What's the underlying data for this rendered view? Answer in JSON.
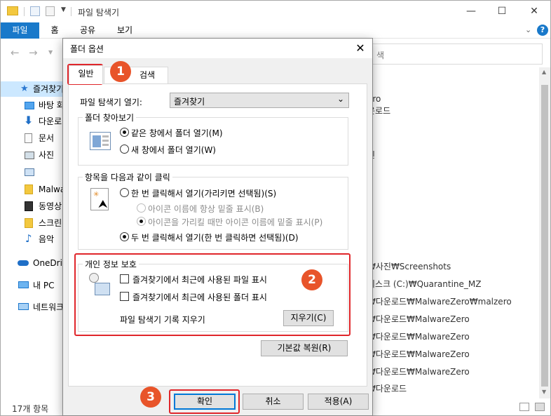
{
  "explorer": {
    "window_title": "파일 탐색기",
    "ribbon": {
      "file": "파일",
      "home": "홈",
      "share": "공유",
      "view": "보기"
    },
    "search_partial": "색",
    "nav_items": [
      "즐겨찾기",
      "바탕 화",
      "다운로",
      "문서",
      "사진",
      "",
      "Malwa",
      "동영상",
      "스크린",
      "음악",
      "OneDriv",
      "내 PC",
      "네트워크"
    ],
    "right_top": [
      "ero",
      "운로드",
      "진"
    ],
    "right_paths": [
      "₩사진₩Screenshots",
      "디스크 (C:)₩Quarantine_MZ",
      "₩다운로드₩MalwareZero₩malzero",
      "₩다운로드₩MalwareZero",
      "₩다운로드₩MalwareZero",
      "₩다운로드₩MalwareZero",
      "₩다운로드₩MalwareZero",
      "₩다운로드"
    ],
    "status_text": "17개 항목"
  },
  "dialog": {
    "title": "폴더 옵션",
    "tabs": [
      "일반",
      "검색"
    ],
    "open_explorer_label": "파일 탐색기 열기:",
    "open_explorer_value": "즐겨찾기",
    "browse_group": {
      "title": "폴더 찾아보기",
      "options": [
        "같은 창에서 폴더 열기(M)",
        "새 창에서 폴더 열기(W)"
      ]
    },
    "click_group": {
      "title": "항목을 다음과 같이 클릭",
      "single": "한 번 클릭해서 열기(가리키면 선택됨)(S)",
      "sub_always": "아이콘 이름에 항상 밑줄 표시(B)",
      "sub_hover": "아이콘을 가리킬 때만 아이콘 이름에 밑줄 표시(P)",
      "double": "두 번 클릭해서 열기(한 번 클릭하면 선택됨)(D)"
    },
    "privacy_group": {
      "title": "개인 정보 보호",
      "recent_files": "즐겨찾기에서 최근에 사용된 파일 표시",
      "recent_folders": "즐겨찾기에서 최근에 사용된 폴더 표시",
      "clear_label": "파일 탐색기 기록 지우기",
      "clear_button": "지우기(C)"
    },
    "restore_button": "기본값 복원(R)",
    "ok_button": "확인",
    "cancel_button": "취소",
    "apply_button": "적용(A)"
  },
  "badges": [
    "1",
    "2",
    "3"
  ],
  "colors": {
    "accent": "#1979ca",
    "highlight_box": "#e0262b",
    "badge": "#e8542a"
  }
}
